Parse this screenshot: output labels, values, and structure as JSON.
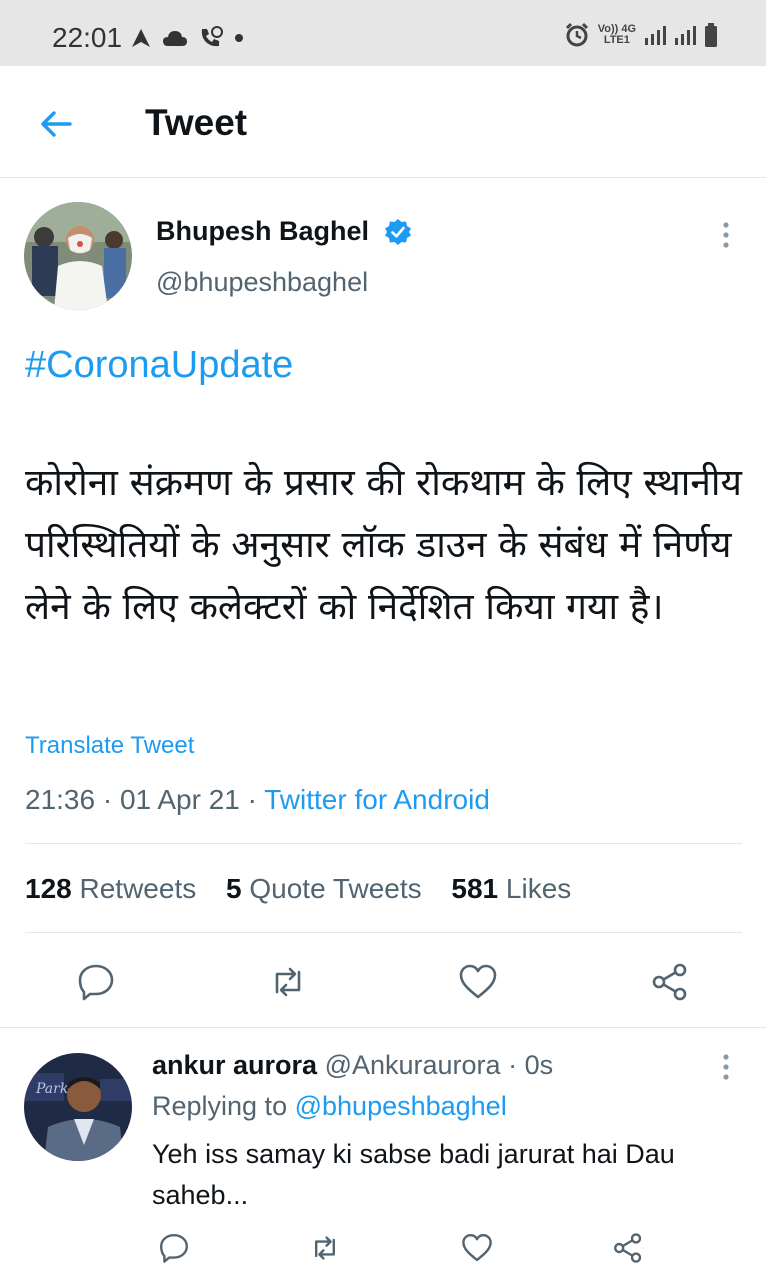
{
  "status_bar": {
    "time": "22:01",
    "left_icons": [
      "navigation-icon",
      "cloud-icon",
      "call-icon",
      "dot-icon"
    ],
    "network_top": "Vo)) 4G",
    "network_bottom": "LTE1",
    "right_icons": [
      "alarm-icon",
      "signal-icon",
      "signal-icon",
      "battery-icon"
    ]
  },
  "header": {
    "title": "Tweet",
    "back_icon": "arrow-left-icon"
  },
  "tweet": {
    "author_name": "Bhupesh Baghel",
    "author_handle": "@bhupeshbaghel",
    "hashtag": "#CoronaUpdate",
    "text": "कोरोना संक्रमण के प्रसार की रोकथाम के लिए स्थानीय परिस्थितियों के अनुसार लॉक डाउन के संबंध में निर्णय  लेने के लिए कलेक्टरों को निर्देशित किया गया है।",
    "translate_label": "Translate Tweet",
    "time": "21:36",
    "date": "01 Apr 21",
    "source": "Twitter for Android",
    "separator": "·",
    "retweets_count": "128",
    "retweets_label": "Retweets",
    "quotes_count": "5",
    "quotes_label": "Quote Tweets",
    "likes_count": "581",
    "likes_label": "Likes",
    "colors": {
      "accent": "#1d9bf0",
      "muted": "#536471",
      "text": "#0f1419"
    }
  },
  "reply": {
    "name": "ankur aurora",
    "handle": "@Ankuraurora",
    "age": "0s",
    "separator": "·",
    "replying_label": "Replying to",
    "replying_handle": "@bhupeshbaghel",
    "text": "Yeh iss samay ki sabse badi jarurat hai Dau saheb..."
  }
}
